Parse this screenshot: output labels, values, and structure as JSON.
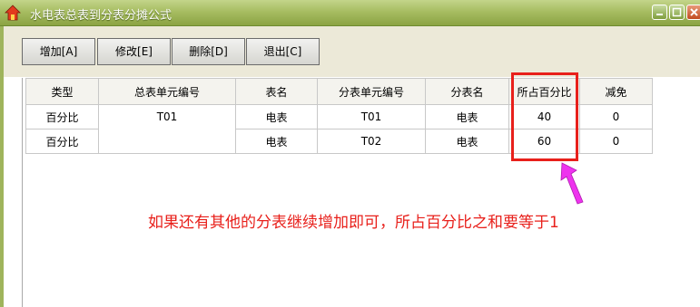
{
  "window": {
    "title": "水电表总表到分表分摊公式"
  },
  "toolbar": {
    "buttons": [
      "增加[A]",
      "修改[E]",
      "删除[D]",
      "退出[C]"
    ]
  },
  "table": {
    "headers": [
      "类型",
      "总表单元编号",
      "表名",
      "分表单元编号",
      "分表名",
      "所占百分比",
      "减免"
    ],
    "rows": [
      [
        "百分比",
        "T01",
        "电表",
        "T01",
        "电表",
        "40",
        "0"
      ],
      [
        "百分比",
        "",
        "电表",
        "T02",
        "电表",
        "60",
        "0"
      ]
    ]
  },
  "annotation": {
    "text": "如果还有其他的分表继续增加即可，所占百分比之和要等于1",
    "color": "#e8201b",
    "arrow_color": "#ee33ee"
  },
  "colors": {
    "titlebar": "#a7bd62",
    "toolbar_bg": "#ece9d8"
  }
}
